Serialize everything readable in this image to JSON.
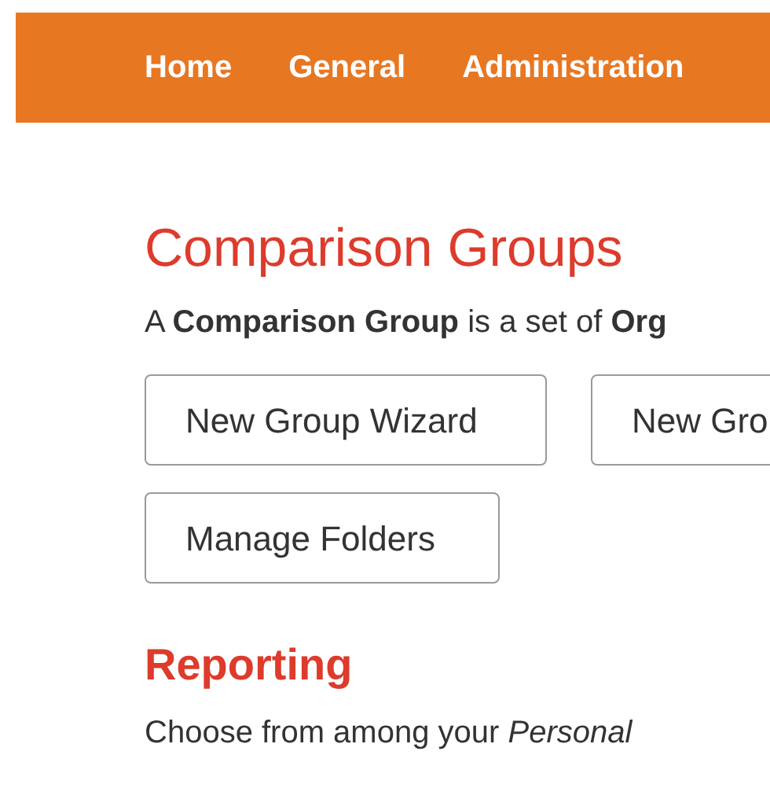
{
  "nav": {
    "items": [
      "Home",
      "General",
      "Administration"
    ]
  },
  "title": "Comparison Groups",
  "intro": "A **Comparison Group** is a set of **Org**",
  "buttons": [
    "New Group Wizard",
    "New Gro",
    "Manage Folders"
  ],
  "reporting": {
    "heading": "Reporting",
    "text": "Choose from among your *Personal*"
  }
}
